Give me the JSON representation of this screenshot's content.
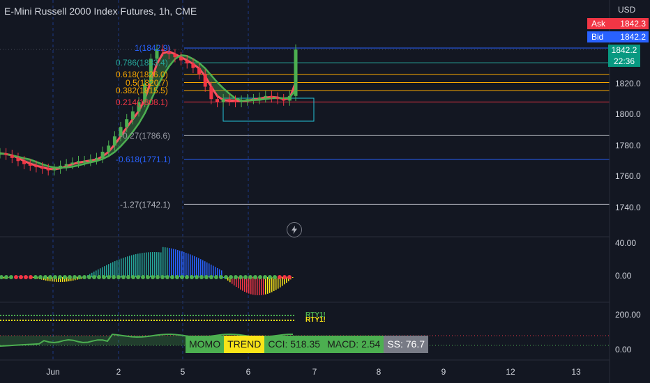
{
  "header": {
    "symbol_title": "E-Mini Russell 2000 Index Futures, 1h, CME",
    "currency": "USD"
  },
  "quotes": {
    "ask_label": "Ask",
    "ask_value": "1842.3",
    "bid_label": "Bid",
    "bid_value": "1842.2",
    "last_price": "1842.2",
    "countdown": "22:36"
  },
  "price_axis": [
    "1820.0",
    "1800.0",
    "1780.0",
    "1760.0",
    "1740.0"
  ],
  "momentum_axis": [
    "40.00",
    "0.00"
  ],
  "cci_axis": [
    "200.00",
    "0.00"
  ],
  "time_axis": [
    "Jun",
    "2",
    "5",
    "6",
    "7",
    "8",
    "9",
    "12",
    "13"
  ],
  "fib_levels": [
    {
      "text": "1(1842.9)",
      "price": 1842.9,
      "color": "#2962ff"
    },
    {
      "text": "0.786(1833.4)",
      "price": 1833.4,
      "color": "#26a69a"
    },
    {
      "text": "0.618(1826.0)",
      "price": 1826.0,
      "color": "#f7a600"
    },
    {
      "text": "0.5(1820.7)",
      "price": 1820.7,
      "color": "#f7a600"
    },
    {
      "text": "0.382(1815.5)",
      "price": 1815.5,
      "color": "#f7a600"
    },
    {
      "text": "0.214(1808.1)",
      "price": 1808.1,
      "color": "#f23645"
    },
    {
      "text": "-0.27(1786.6)",
      "price": 1786.6,
      "color": "#9598a1"
    },
    {
      "text": "-0.618(1771.1)",
      "price": 1771.1,
      "color": "#2962ff"
    },
    {
      "text": "-1.27(1742.1)",
      "price": 1742.1,
      "color": "#b2b5be"
    }
  ],
  "indicator_tags": {
    "tag1": "RTY1!",
    "tag2": "RTY1!"
  },
  "status_bar": {
    "momo": "MOMO",
    "trend": "TREND",
    "cci": "CCI: 518.35",
    "macd": "MACD: 2.54",
    "ss": "SS: 76.7"
  },
  "colors": {
    "background": "#131722",
    "bull": "#4caf50",
    "bear": "#f23645",
    "ask": "#f23645",
    "bid": "#2962ff",
    "last": "#089981"
  },
  "icons": {
    "replay": "lightning-icon"
  },
  "chart_data": {
    "type": "line",
    "title": "E-Mini Russell 2000 Index Futures, 1h, CME",
    "ylim": [
      1735,
      1852
    ],
    "series": [
      {
        "name": "price",
        "values": [
          1775,
          1774,
          1772,
          1770,
          1768,
          1767,
          1766,
          1765,
          1764,
          1765,
          1767,
          1768,
          1769,
          1770,
          1770,
          1771,
          1772,
          1776,
          1780,
          1786,
          1792,
          1797,
          1802,
          1808,
          1820,
          1836,
          1842,
          1841,
          1839,
          1837,
          1835,
          1833,
          1830,
          1826,
          1818,
          1810,
          1808,
          1810,
          1809,
          1808,
          1809,
          1810,
          1810,
          1811,
          1812,
          1811,
          1810,
          1809,
          1812,
          1842
        ]
      }
    ]
  }
}
